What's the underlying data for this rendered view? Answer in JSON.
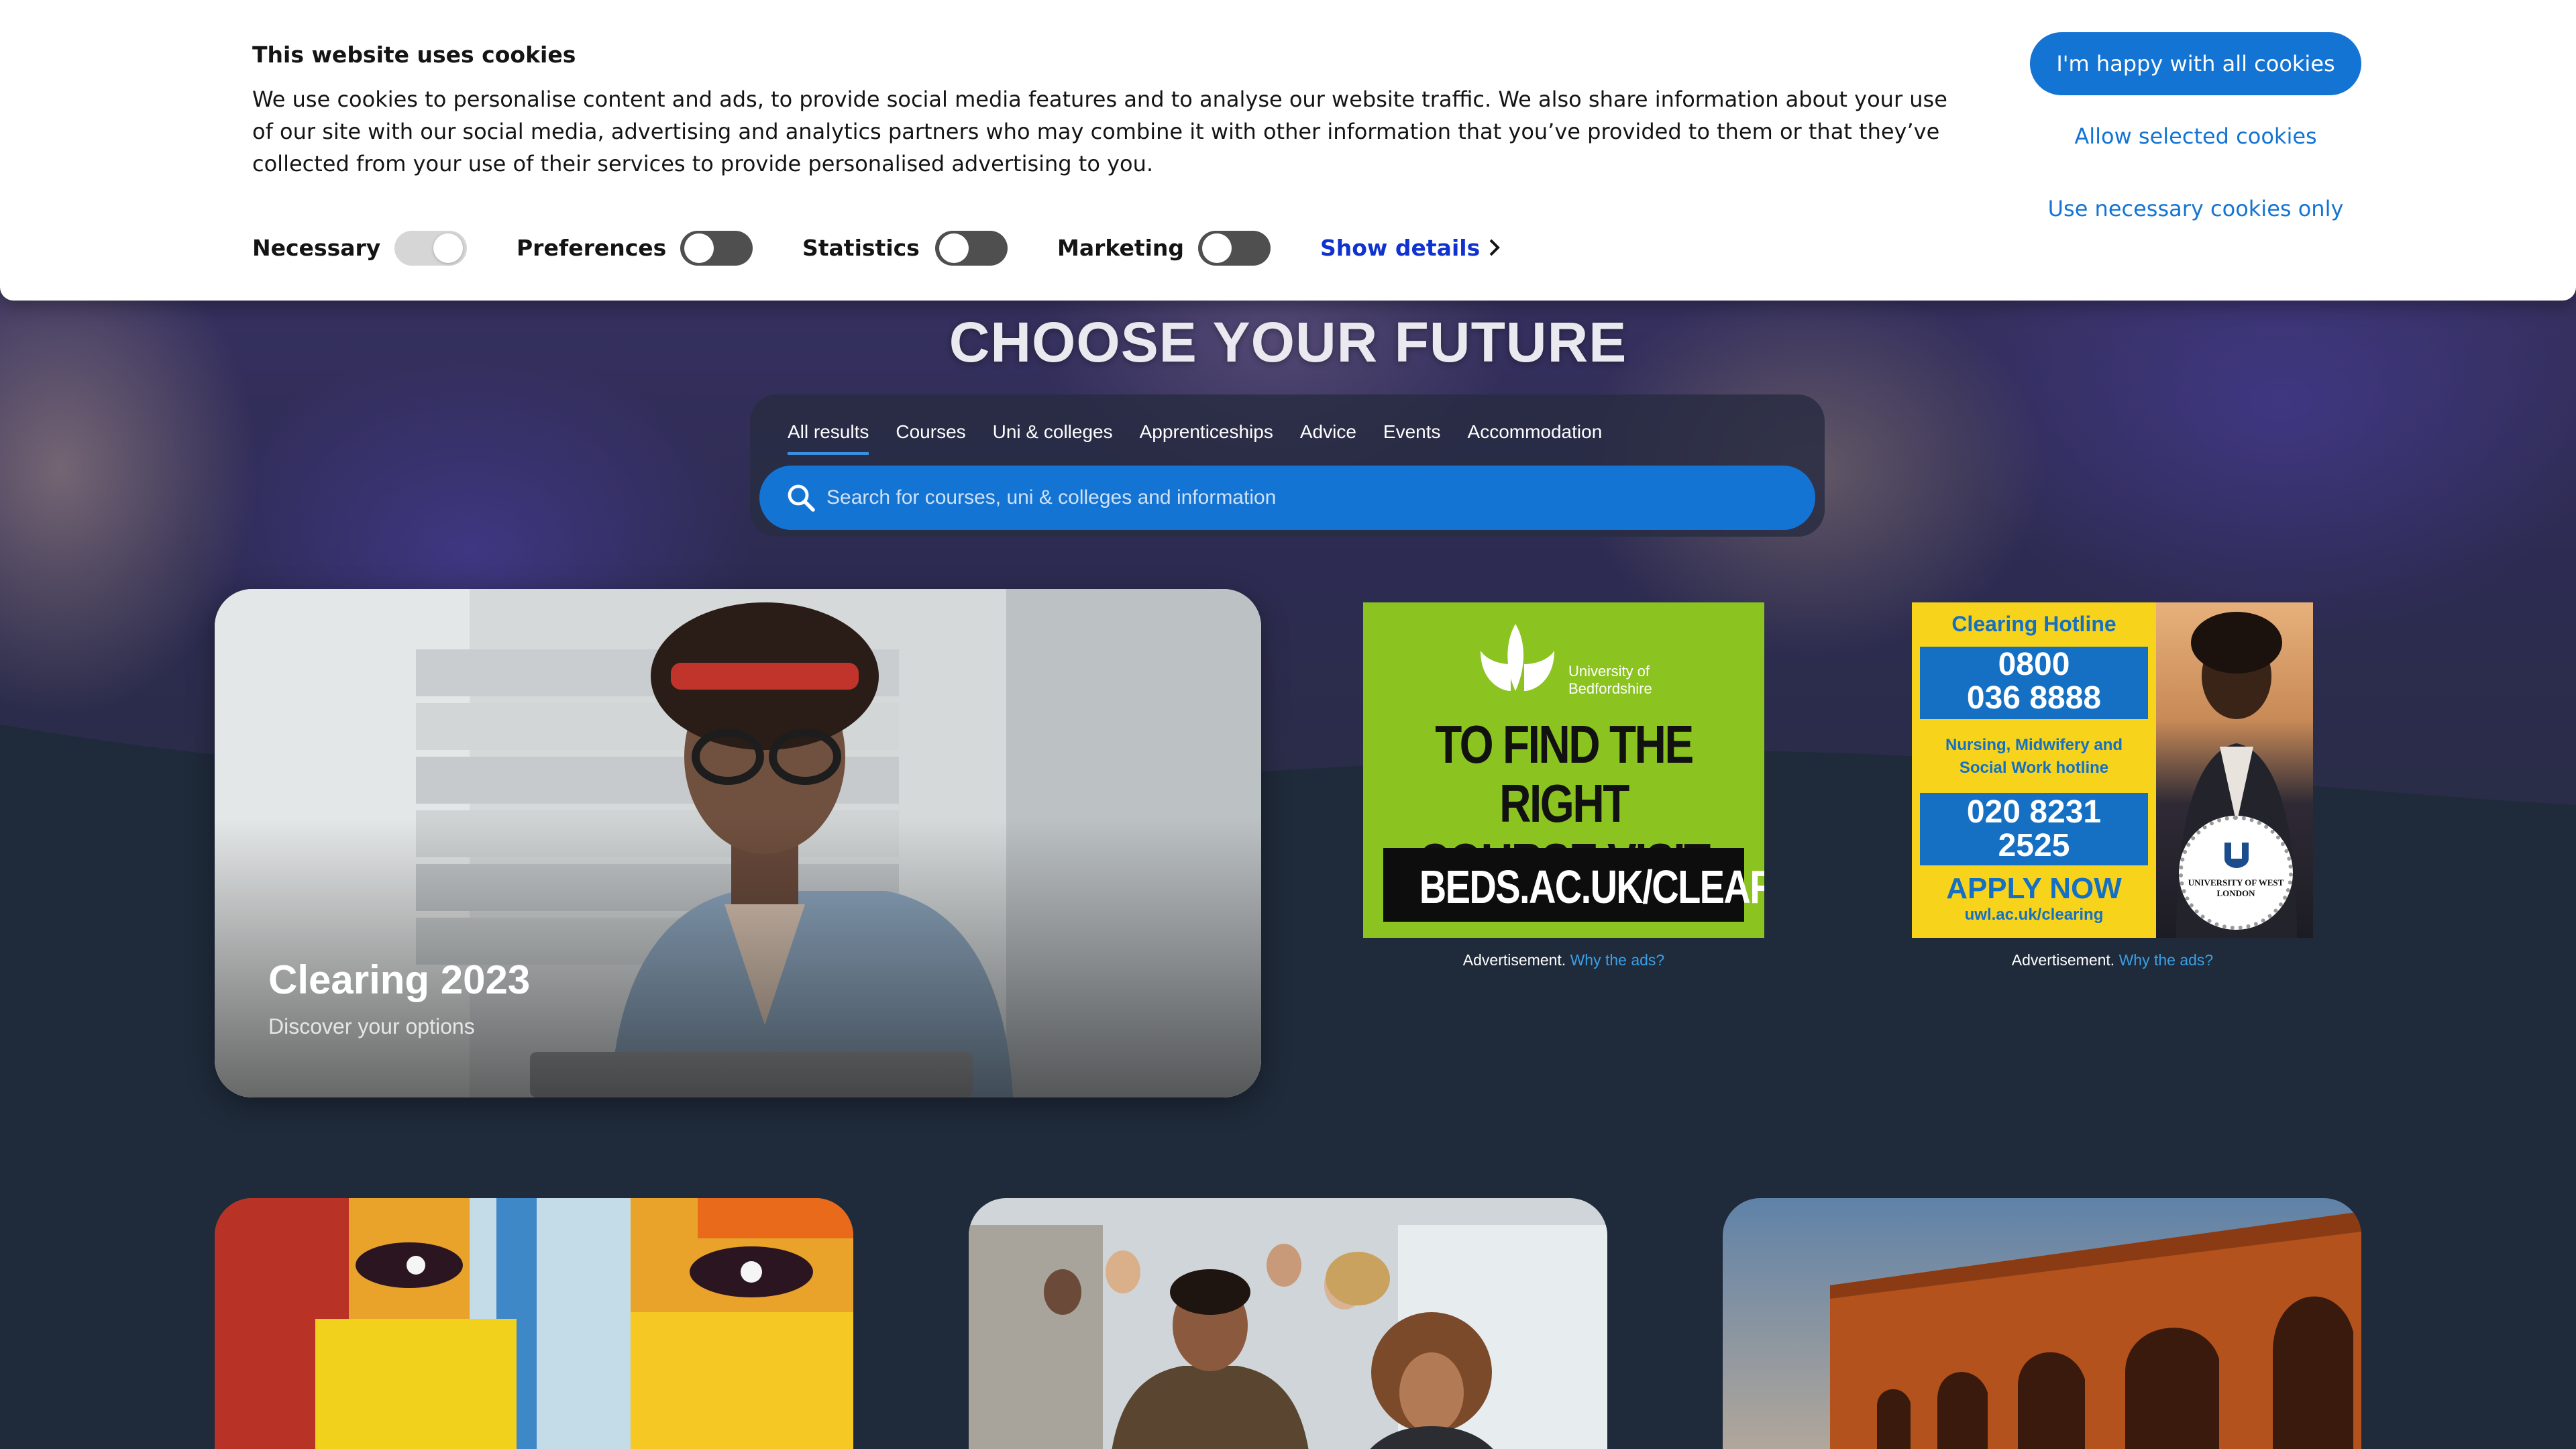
{
  "cookie_banner": {
    "title": "This website uses cookies",
    "text": "We use cookies to personalise content and ads, to provide social media features and to analyse our website traffic. We also share information about your use of our site with our social media, advertising and analytics partners who may combine it with other information that you’ve provided to them or that they’ve collected from your use of their services to provide personalised advertising to you.",
    "toggles": {
      "necessary": "Necessary",
      "preferences": "Preferences",
      "statistics": "Statistics",
      "marketing": "Marketing"
    },
    "show_details": "Show details",
    "accept_all": "I'm happy with all cookies",
    "allow_selected": "Allow selected cookies",
    "necessary_only": "Use necessary cookies only"
  },
  "hero": {
    "title": "CHOOSE YOUR FUTURE"
  },
  "search": {
    "tabs": [
      "All results",
      "Courses",
      "Uni & colleges",
      "Apprenticeships",
      "Advice",
      "Events",
      "Accommodation"
    ],
    "placeholder": "Search for courses, uni & colleges and information"
  },
  "feature_card": {
    "title": "Clearing 2023",
    "subtitle": "Discover your options"
  },
  "ads": {
    "beds": {
      "university": "University of Bedfordshire",
      "uni_line1": "University of",
      "uni_line2": "Bedfordshire",
      "headline_line1": "TO FIND THE RIGHT",
      "headline_line2": "COURSE VISIT",
      "url": "BEDS.AC.UK/CLEARING"
    },
    "uwl": {
      "hotline_label": "Clearing Hotline",
      "phone1_line1": "0800",
      "phone1_line2": "036 8888",
      "nursing_line1": "Nursing, Midwifery and",
      "nursing_line2": "Social Work hotline",
      "phone2_line1": "020 8231",
      "phone2_line2": "2525",
      "apply": "APPLY NOW",
      "url": "uwl.ac.uk/clearing",
      "seal": "UNIVERSITY OF WEST LONDON"
    },
    "caption": "Advertisement.",
    "why": "Why the ads?"
  },
  "colors": {
    "primary_blue": "#1374d4",
    "page_dark": "#1f2a3a",
    "beds_green": "#8bc320",
    "uwl_yellow": "#f7d41b",
    "uwl_blue": "#1570c3",
    "details_link": "#1032cf"
  },
  "icons": {
    "search": "search-icon",
    "chevron": "chevron-right-icon"
  }
}
